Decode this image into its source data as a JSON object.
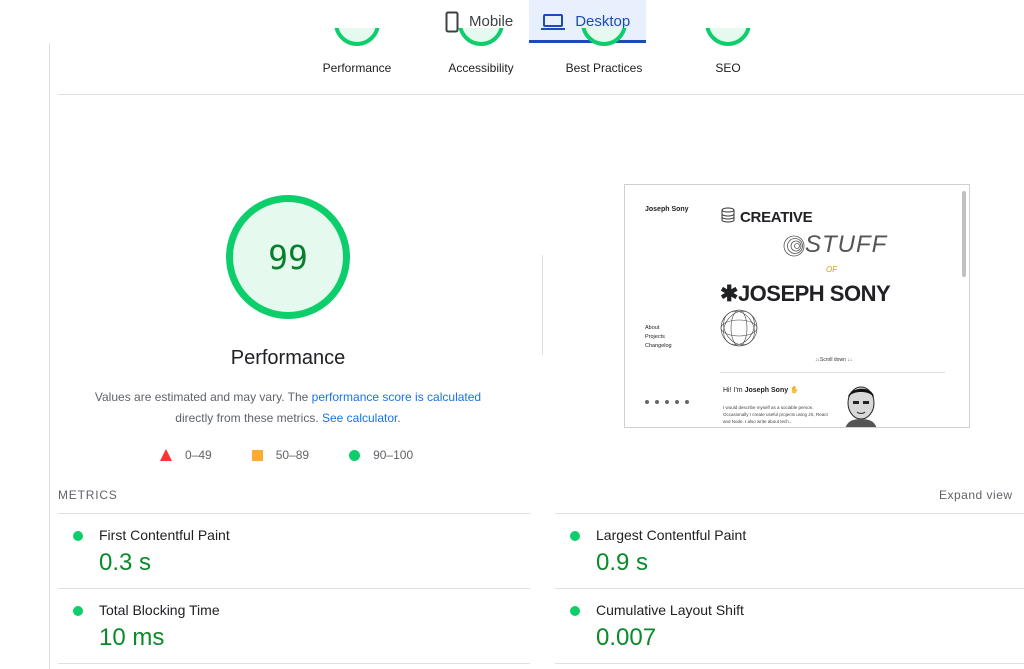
{
  "device_tabs": [
    {
      "label": "Mobile",
      "icon": "phone-icon",
      "active": false
    },
    {
      "label": "Desktop",
      "icon": "laptop-icon",
      "active": true
    }
  ],
  "categories": [
    {
      "label": "Performance"
    },
    {
      "label": "Accessibility"
    },
    {
      "label": "Best Practices"
    },
    {
      "label": "SEO"
    }
  ],
  "gauge": {
    "score": "99",
    "title": "Performance",
    "note_prefix": "Values are estimated and may vary. The ",
    "note_link1": "performance score is calculated",
    "note_middle": " directly from these metrics. ",
    "note_link2": "See calculator",
    "note_suffix": "."
  },
  "legend": {
    "fail": "0–49",
    "average": "50–89",
    "pass": "90–100"
  },
  "screenshot": {
    "name": "Joseph Sony",
    "nav": [
      "About",
      "Projects",
      "Changelog"
    ],
    "creative": "CREATIVE",
    "stuff": "STUFF",
    "of": "OF",
    "big_name": "JOSEPH SONY",
    "scroll_hint": "↓↓Scroll down ↓↓",
    "hi_prefix": "Hi! I'm ",
    "hi_name": "Joseph Sony",
    "body": "I would describe myself as a sociable person. Occasionally I create useful projects using JS, React and Node. I also write about tech..."
  },
  "metrics": {
    "heading": "METRICS",
    "expand": "Expand view",
    "items": [
      {
        "label": "First Contentful Paint",
        "value": "0.3 s"
      },
      {
        "label": "Largest Contentful Paint",
        "value": "0.9 s"
      },
      {
        "label": "Total Blocking Time",
        "value": "10 ms"
      },
      {
        "label": "Cumulative Layout Shift",
        "value": "0.007"
      }
    ]
  },
  "colors": {
    "pass": "#0cce6b",
    "pass_text": "#0a8a2a",
    "average": "#ffaa33",
    "fail": "#ff3333",
    "link": "#1a73e8",
    "active_tab": "#1a4db3"
  }
}
